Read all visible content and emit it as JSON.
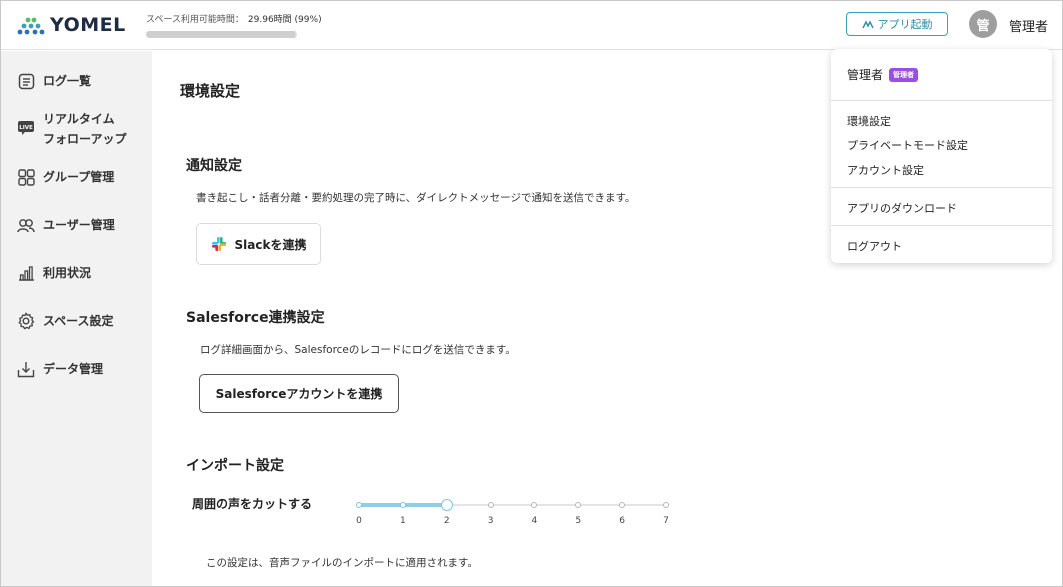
{
  "header": {
    "logo_text": "YOMEL",
    "storage_label": "スペース利用可能時間：",
    "storage_value": "29.96時間 (99%)",
    "storage_percent": 99,
    "app_button_label": "アプリ起動",
    "avatar_initial": "管",
    "user_name": "管理者"
  },
  "sidebar": {
    "items": [
      {
        "label": "ログ一覧",
        "icon": "document-list-icon"
      },
      {
        "label": "リアルタイム",
        "label2": "フォローアップ",
        "icon": "live-icon"
      },
      {
        "label": "グループ管理",
        "icon": "grid-icon"
      },
      {
        "label": "ユーザー管理",
        "icon": "users-icon"
      },
      {
        "label": "利用状況",
        "icon": "bar-chart-icon"
      },
      {
        "label": "スペース設定",
        "icon": "gear-icon"
      },
      {
        "label": "データ管理",
        "icon": "download-tray-icon"
      }
    ]
  },
  "main": {
    "title": "環境設定",
    "notification": {
      "title": "通知設定",
      "desc": "書き起こし・話者分離・要約処理の完了時に、ダイレクトメッセージで通知を送信できます。",
      "button": "Slackを連携"
    },
    "salesforce": {
      "title": "Salesforce連携設定",
      "desc": "ログ詳細画面から、Salesforceのレコードにログを送信できます。",
      "button": "Salesforceアカウントを連携"
    },
    "import": {
      "title": "インポート設定",
      "slider_label": "周囲の声をカットする",
      "slider_value": 2,
      "slider_ticks": [
        "0",
        "1",
        "2",
        "3",
        "4",
        "5",
        "6",
        "7"
      ],
      "note": "この設定は、音声ファイルのインポートに適用されます。"
    }
  },
  "dropdown": {
    "name": "管理者",
    "badge": "管理者",
    "items": [
      "環境設定",
      "プライベートモード設定",
      "アカウント設定"
    ],
    "download": "アプリのダウンロード",
    "logout": "ログアウト"
  },
  "colors": {
    "accent": "#3aa0b9",
    "badge": "#9b4fe0",
    "slider_fill": "#8ccfe6",
    "sidebar_bg": "#f2f2f2"
  }
}
